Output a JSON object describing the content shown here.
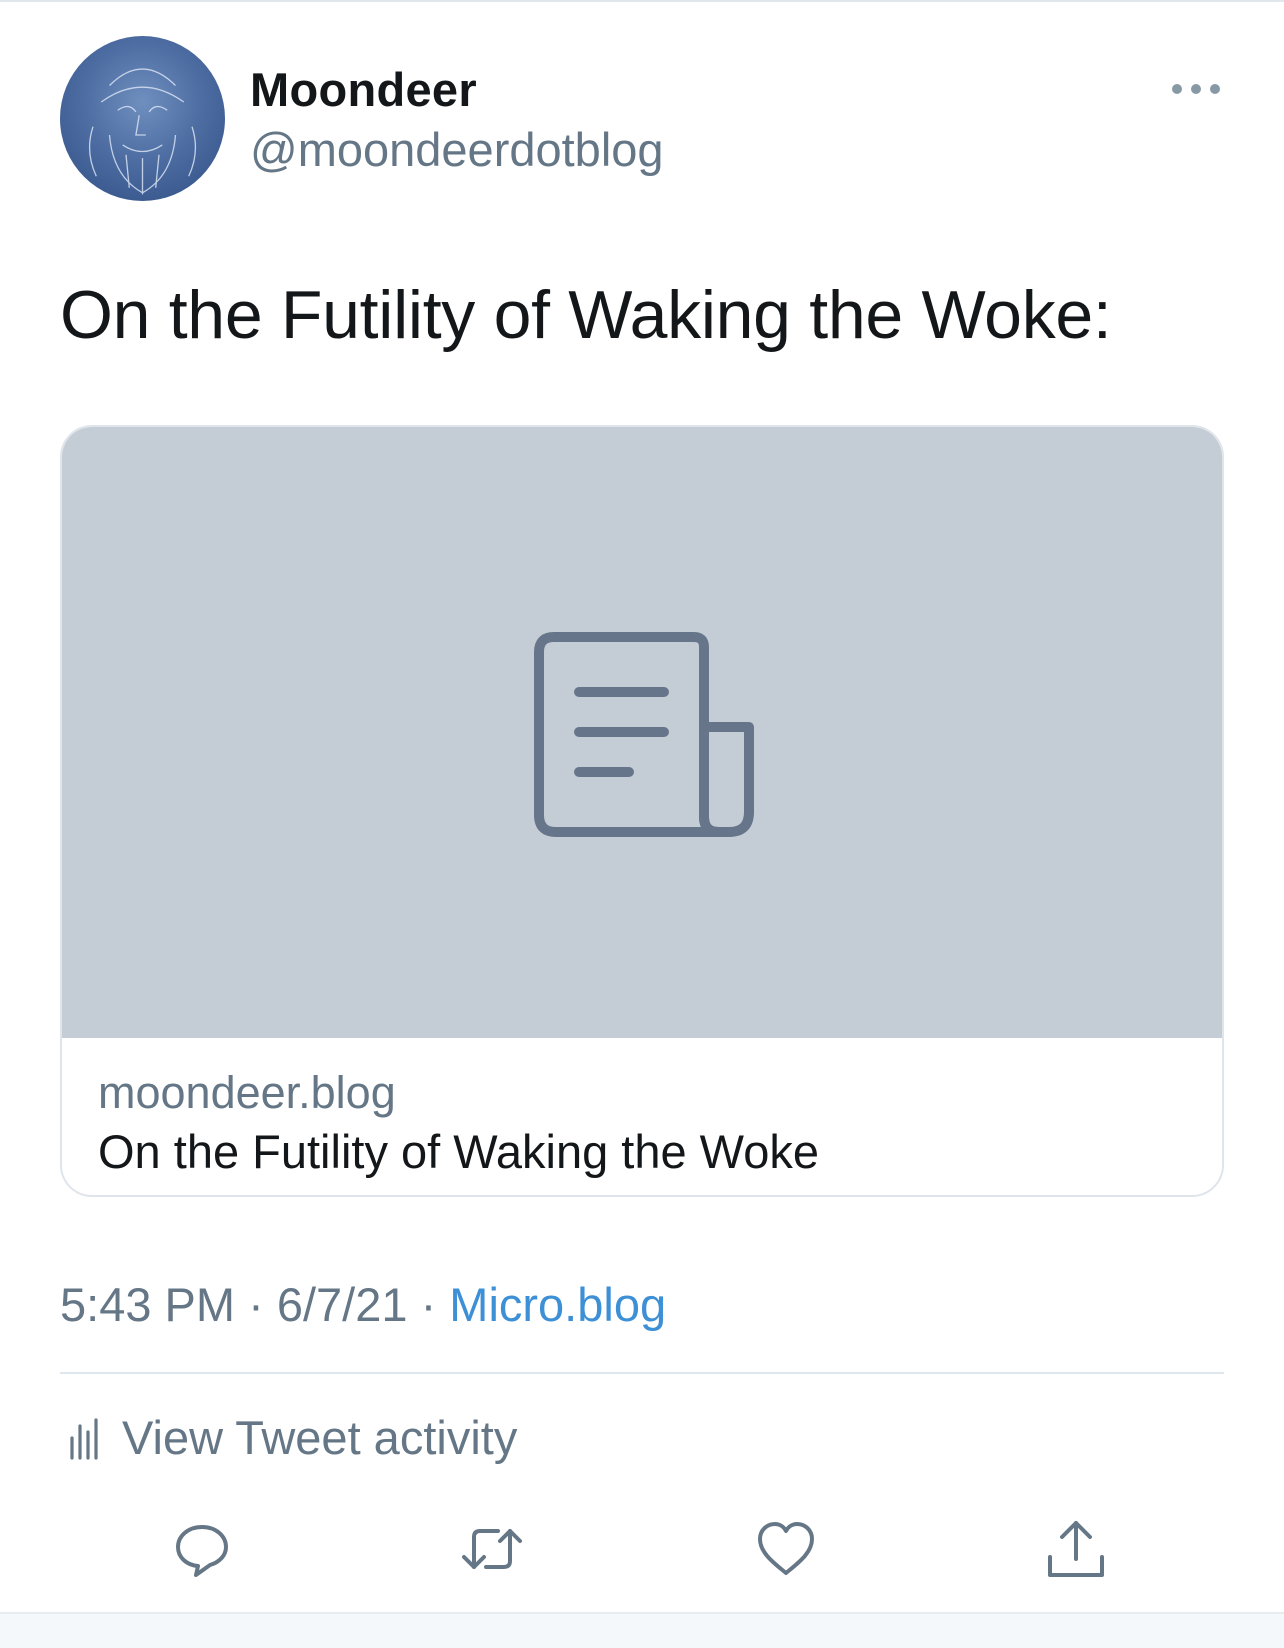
{
  "author": {
    "display_name": "Moondeer",
    "handle": "@moondeerdotblog",
    "avatar_icon": "avatar"
  },
  "tweet": {
    "text": "On the Futility of Waking the Woke:"
  },
  "card": {
    "placeholder_icon": "article-icon",
    "domain": "moondeer.blog",
    "title": "On the Futility of Waking the Woke"
  },
  "meta": {
    "time": "5:43 PM",
    "sep1": " · ",
    "date": "6/7/21",
    "sep2": " · ",
    "source": "Micro.blog"
  },
  "activity": {
    "label": "View Tweet activity"
  },
  "actions": {
    "icons": [
      "reply-icon",
      "retweet-icon",
      "like-icon",
      "share-icon"
    ]
  },
  "colors": {
    "text_primary": "#14171a",
    "text_secondary": "#657786",
    "link": "#3d8fd6",
    "card_media": "#c4cdd5",
    "icon": "#657786"
  }
}
